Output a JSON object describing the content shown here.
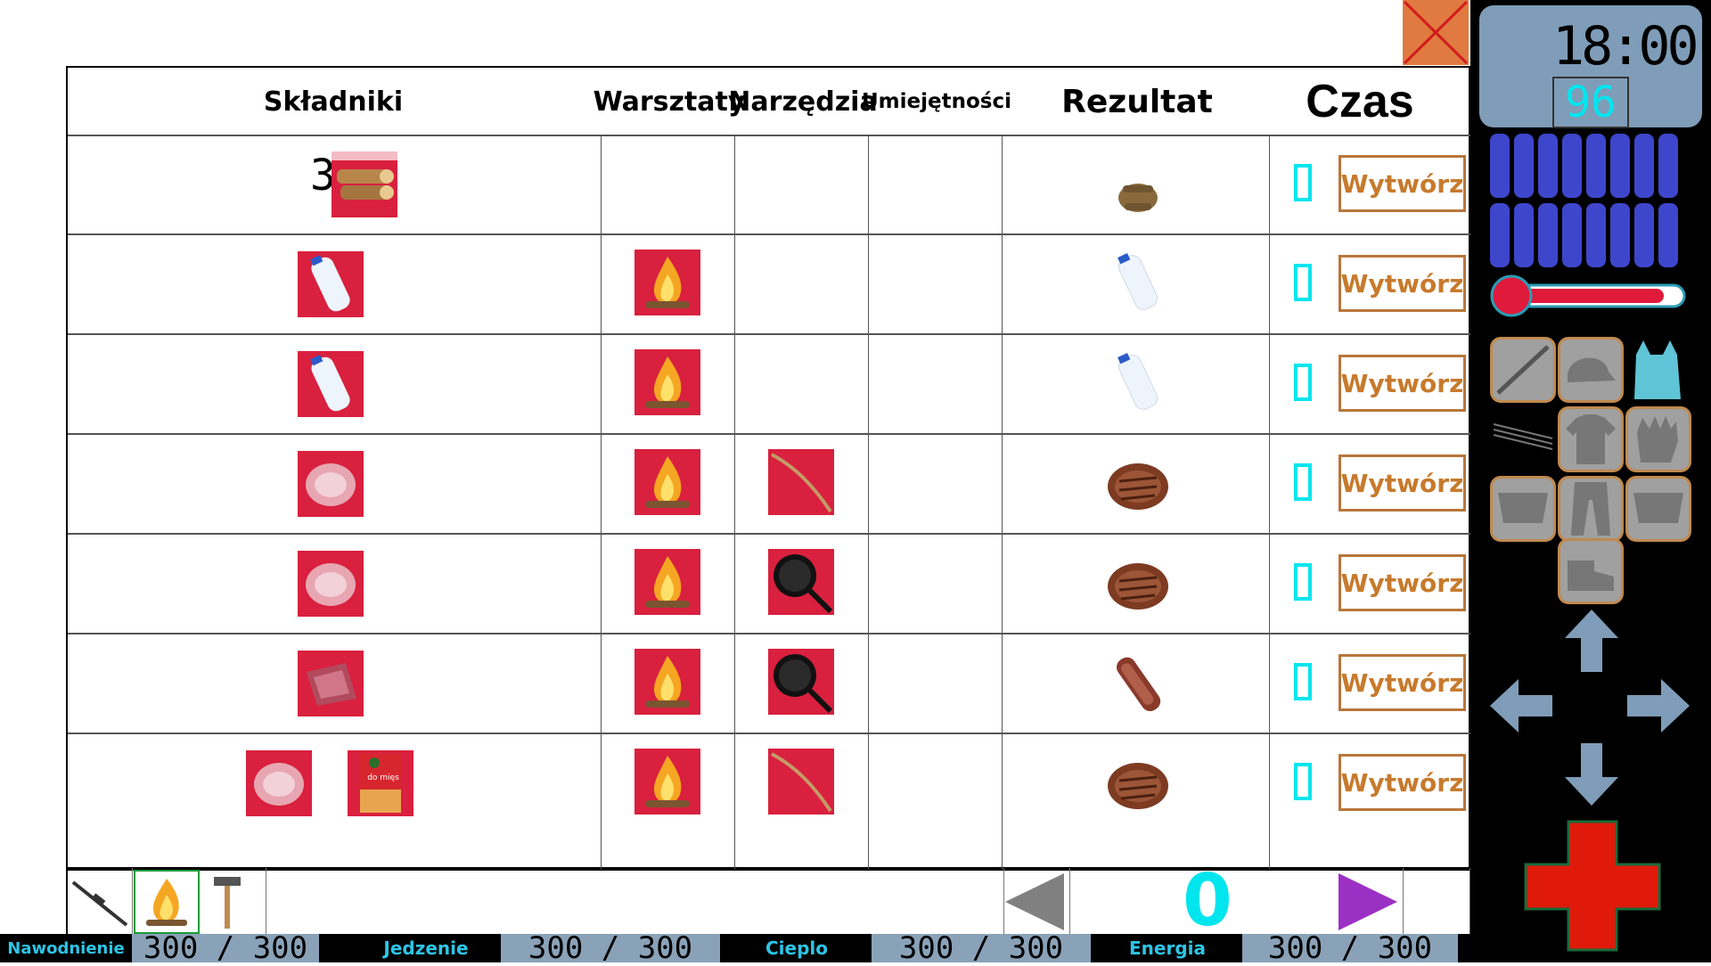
{
  "headers": {
    "ingredients": "Składniki",
    "workshops": "Warsztaty",
    "tools": "Narzędzia",
    "skills": "Umiejętności",
    "result": "Rezultat",
    "time": "Czas"
  },
  "recipes": [
    {
      "ingredients": [
        {
          "icon": "wood-logs-icon",
          "count_label": "3x"
        }
      ],
      "workshop": "",
      "tool": "",
      "result": "kindling-icon",
      "time": "0",
      "button": "Wytwórz"
    },
    {
      "ingredients": [
        {
          "icon": "water-bottle-icon"
        }
      ],
      "workshop": "campfire-icon",
      "tool": "",
      "result": "water-bottle-icon",
      "time": "0",
      "button": "Wytwórz"
    },
    {
      "ingredients": [
        {
          "icon": "water-bottle-icon"
        }
      ],
      "workshop": "campfire-icon",
      "tool": "",
      "result": "water-bottle-icon",
      "time": "0",
      "button": "Wytwórz"
    },
    {
      "ingredients": [
        {
          "icon": "raw-meat-icon"
        }
      ],
      "workshop": "campfire-icon",
      "tool": "stick-icon",
      "result": "cooked-steak-icon",
      "time": "0",
      "button": "Wytwórz"
    },
    {
      "ingredients": [
        {
          "icon": "raw-meat-icon"
        }
      ],
      "workshop": "campfire-icon",
      "tool": "frying-pan-icon",
      "result": "cooked-steak-icon",
      "time": "0",
      "button": "Wytwórz"
    },
    {
      "ingredients": [
        {
          "icon": "raw-fish-meat-icon"
        }
      ],
      "workshop": "campfire-icon",
      "tool": "frying-pan-icon",
      "result": "fried-fish-icon",
      "time": "0",
      "button": "Wytwórz"
    },
    {
      "ingredients": [
        {
          "icon": "raw-meat-icon"
        },
        {
          "icon": "seasoning-packet-icon",
          "packet_text": "do mięs"
        }
      ],
      "workshop": "campfire-icon",
      "tool": "stick-icon",
      "result": "cooked-steak-icon",
      "time": "0",
      "button": "Wytwórz"
    }
  ],
  "tabs": [
    "rifle-icon",
    "campfire-icon",
    "hammer-icon"
  ],
  "page_number": "0",
  "stats": [
    {
      "label": "Nawodnienie",
      "value": "300 / 300"
    },
    {
      "label": "Jedzenie",
      "value": "300 / 300"
    },
    {
      "label": "Cieplo",
      "value": "300 / 300"
    },
    {
      "label": "Energia",
      "value": "300 / 300"
    }
  ],
  "clock": {
    "time": "18:00",
    "day": "96"
  },
  "battery_cells": 16,
  "temperature_level": 0.9,
  "colors": {
    "ingredient_bg": "#d9203e",
    "button_border": "#b8763a",
    "button_text": "#c77a2c",
    "qty_cyan": "#00e5ee",
    "stat_label": "#2ec4e6",
    "panel_blue": "#7f9db8",
    "battery_blue": "#3e46cc",
    "next_arrow": "#9b30c4",
    "prev_arrow": "#808080",
    "medical_red": "#e01a0a"
  }
}
